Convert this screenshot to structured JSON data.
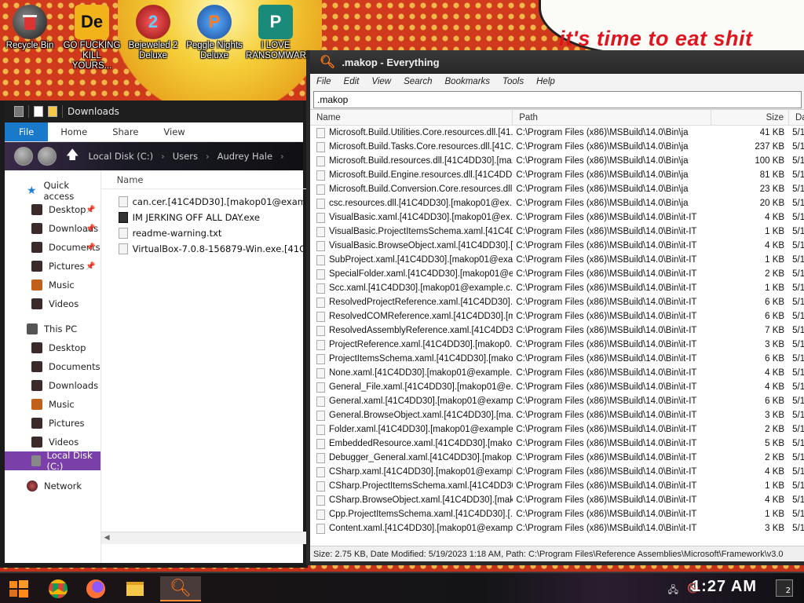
{
  "desktop": {
    "icons": [
      {
        "label": "Recycle Bin",
        "icon": "recycle-bin-icon"
      },
      {
        "label": "GO FUCKING KILL YOURS...",
        "icon": "app-icon-de"
      },
      {
        "label": "Bejeweled 2 Deluxe",
        "icon": "bejeweled-icon"
      },
      {
        "label": "Peggle Nights Deluxe",
        "icon": "peggle-icon"
      },
      {
        "label": "I LOVE RANSOMWARE",
        "icon": "publisher-icon"
      }
    ],
    "icon_glyphs": {
      "de": "De",
      "bejeweled": "2",
      "peggle": "P",
      "publisher": "P"
    },
    "wallpaper_text": "it's time to eat shit"
  },
  "explorer": {
    "title": "Downloads",
    "ribbon": {
      "file": "File",
      "home": "Home",
      "share": "Share",
      "view": "View"
    },
    "address": {
      "part1": "Local Disk (C:)",
      "part2": "Users",
      "part3": "Audrey Hale"
    },
    "nav": {
      "quick_access": "Quick access",
      "qa_items": [
        "Desktop",
        "Downloads",
        "Documents",
        "Pictures",
        "Music",
        "Videos"
      ],
      "this_pc": "This PC",
      "pc_items": [
        "Desktop",
        "Documents",
        "Downloads",
        "Music",
        "Pictures",
        "Videos",
        "Local Disk (C:)"
      ],
      "network": "Network"
    },
    "list_header": "Name",
    "files": [
      "can.cer.[41C4DD30].[makop01@example.com]",
      "IM JERKING OFF ALL DAY.exe",
      "readme-warning.txt",
      "VirtualBox-7.0.8-156879-Win.exe.[41C4DD30]"
    ]
  },
  "everything": {
    "title": ".makop - Everything",
    "menu": [
      "File",
      "Edit",
      "View",
      "Search",
      "Bookmarks",
      "Tools",
      "Help"
    ],
    "search_value": ".makop",
    "columns": {
      "name": "Name",
      "path": "Path",
      "size": "Size",
      "date": "Da"
    },
    "rows": [
      {
        "name": "Microsoft.Build.Utilities.Core.resources.dll.[41...",
        "path": "C:\\Program Files (x86)\\MSBuild\\14.0\\Bin\\ja",
        "size": "41 KB",
        "date": "5/1"
      },
      {
        "name": "Microsoft.Build.Tasks.Core.resources.dll.[41C...",
        "path": "C:\\Program Files (x86)\\MSBuild\\14.0\\Bin\\ja",
        "size": "237 KB",
        "date": "5/1"
      },
      {
        "name": "Microsoft.Build.resources.dll.[41C4DD30].[ma...",
        "path": "C:\\Program Files (x86)\\MSBuild\\14.0\\Bin\\ja",
        "size": "100 KB",
        "date": "5/1"
      },
      {
        "name": "Microsoft.Build.Engine.resources.dll.[41C4DD...",
        "path": "C:\\Program Files (x86)\\MSBuild\\14.0\\Bin\\ja",
        "size": "81 KB",
        "date": "5/1"
      },
      {
        "name": "Microsoft.Build.Conversion.Core.resources.dll...",
        "path": "C:\\Program Files (x86)\\MSBuild\\14.0\\Bin\\ja",
        "size": "23 KB",
        "date": "5/1"
      },
      {
        "name": "csc.resources.dll.[41C4DD30].[makop01@ex...",
        "path": "C:\\Program Files (x86)\\MSBuild\\14.0\\Bin\\ja",
        "size": "20 KB",
        "date": "5/1"
      },
      {
        "name": "VisualBasic.xaml.[41C4DD30].[makop01@ex...",
        "path": "C:\\Program Files (x86)\\MSBuild\\14.0\\Bin\\it-IT",
        "size": "4 KB",
        "date": "5/1"
      },
      {
        "name": "VisualBasic.ProjectItemsSchema.xaml.[41C4D...",
        "path": "C:\\Program Files (x86)\\MSBuild\\14.0\\Bin\\it-IT",
        "size": "1 KB",
        "date": "5/1"
      },
      {
        "name": "VisualBasic.BrowseObject.xaml.[41C4DD30].[...",
        "path": "C:\\Program Files (x86)\\MSBuild\\14.0\\Bin\\it-IT",
        "size": "4 KB",
        "date": "5/1"
      },
      {
        "name": "SubProject.xaml.[41C4DD30].[makop01@exa...",
        "path": "C:\\Program Files (x86)\\MSBuild\\14.0\\Bin\\it-IT",
        "size": "1 KB",
        "date": "5/1"
      },
      {
        "name": "SpecialFolder.xaml.[41C4DD30].[makop01@e...",
        "path": "C:\\Program Files (x86)\\MSBuild\\14.0\\Bin\\it-IT",
        "size": "2 KB",
        "date": "5/1"
      },
      {
        "name": "Scc.xaml.[41C4DD30].[makop01@example.c...",
        "path": "C:\\Program Files (x86)\\MSBuild\\14.0\\Bin\\it-IT",
        "size": "1 KB",
        "date": "5/1"
      },
      {
        "name": "ResolvedProjectReference.xaml.[41C4DD30]....",
        "path": "C:\\Program Files (x86)\\MSBuild\\14.0\\Bin\\it-IT",
        "size": "6 KB",
        "date": "5/1"
      },
      {
        "name": "ResolvedCOMReference.xaml.[41C4DD30].[m...",
        "path": "C:\\Program Files (x86)\\MSBuild\\14.0\\Bin\\it-IT",
        "size": "6 KB",
        "date": "5/1"
      },
      {
        "name": "ResolvedAssemblyReference.xaml.[41C4DD3...",
        "path": "C:\\Program Files (x86)\\MSBuild\\14.0\\Bin\\it-IT",
        "size": "7 KB",
        "date": "5/1"
      },
      {
        "name": "ProjectReference.xaml.[41C4DD30].[makop0...",
        "path": "C:\\Program Files (x86)\\MSBuild\\14.0\\Bin\\it-IT",
        "size": "3 KB",
        "date": "5/1"
      },
      {
        "name": "ProjectItemsSchema.xaml.[41C4DD30].[mako...",
        "path": "C:\\Program Files (x86)\\MSBuild\\14.0\\Bin\\it-IT",
        "size": "6 KB",
        "date": "5/1"
      },
      {
        "name": "None.xaml.[41C4DD30].[makop01@example...",
        "path": "C:\\Program Files (x86)\\MSBuild\\14.0\\Bin\\it-IT",
        "size": "4 KB",
        "date": "5/1"
      },
      {
        "name": "General_File.xaml.[41C4DD30].[makop01@e...",
        "path": "C:\\Program Files (x86)\\MSBuild\\14.0\\Bin\\it-IT",
        "size": "4 KB",
        "date": "5/1"
      },
      {
        "name": "General.xaml.[41C4DD30].[makop01@examp...",
        "path": "C:\\Program Files (x86)\\MSBuild\\14.0\\Bin\\it-IT",
        "size": "6 KB",
        "date": "5/1"
      },
      {
        "name": "General.BrowseObject.xaml.[41C4DD30].[ma...",
        "path": "C:\\Program Files (x86)\\MSBuild\\14.0\\Bin\\it-IT",
        "size": "3 KB",
        "date": "5/1"
      },
      {
        "name": "Folder.xaml.[41C4DD30].[makop01@example...",
        "path": "C:\\Program Files (x86)\\MSBuild\\14.0\\Bin\\it-IT",
        "size": "2 KB",
        "date": "5/1"
      },
      {
        "name": "EmbeddedResource.xaml.[41C4DD30].[mako...",
        "path": "C:\\Program Files (x86)\\MSBuild\\14.0\\Bin\\it-IT",
        "size": "5 KB",
        "date": "5/1"
      },
      {
        "name": "Debugger_General.xaml.[41C4DD30].[makop...",
        "path": "C:\\Program Files (x86)\\MSBuild\\14.0\\Bin\\it-IT",
        "size": "2 KB",
        "date": "5/1"
      },
      {
        "name": "CSharp.xaml.[41C4DD30].[makop01@exampl...",
        "path": "C:\\Program Files (x86)\\MSBuild\\14.0\\Bin\\it-IT",
        "size": "4 KB",
        "date": "5/1"
      },
      {
        "name": "CSharp.ProjectItemsSchema.xaml.[41C4DD30]...",
        "path": "C:\\Program Files (x86)\\MSBuild\\14.0\\Bin\\it-IT",
        "size": "1 KB",
        "date": "5/1"
      },
      {
        "name": "CSharp.BrowseObject.xaml.[41C4DD30].[mak...",
        "path": "C:\\Program Files (x86)\\MSBuild\\14.0\\Bin\\it-IT",
        "size": "4 KB",
        "date": "5/1"
      },
      {
        "name": "Cpp.ProjectItemsSchema.xaml.[41C4DD30].[...",
        "path": "C:\\Program Files (x86)\\MSBuild\\14.0\\Bin\\it-IT",
        "size": "1 KB",
        "date": "5/1"
      },
      {
        "name": "Content.xaml.[41C4DD30].[makop01@examp...",
        "path": "C:\\Program Files (x86)\\MSBuild\\14.0\\Bin\\it-IT",
        "size": "3 KB",
        "date": "5/1"
      }
    ],
    "status": "Size: 2.75 KB, Date Modified: 5/19/2023 1:18 AM, Path: C:\\Program Files\\Reference Assemblies\\Microsoft\\Framework\\v3.0"
  },
  "taskbar": {
    "clock": "1:27 AM",
    "notification_count": "2",
    "tray_network": "network-icon",
    "tray_sound": "volume-muted-icon"
  }
}
